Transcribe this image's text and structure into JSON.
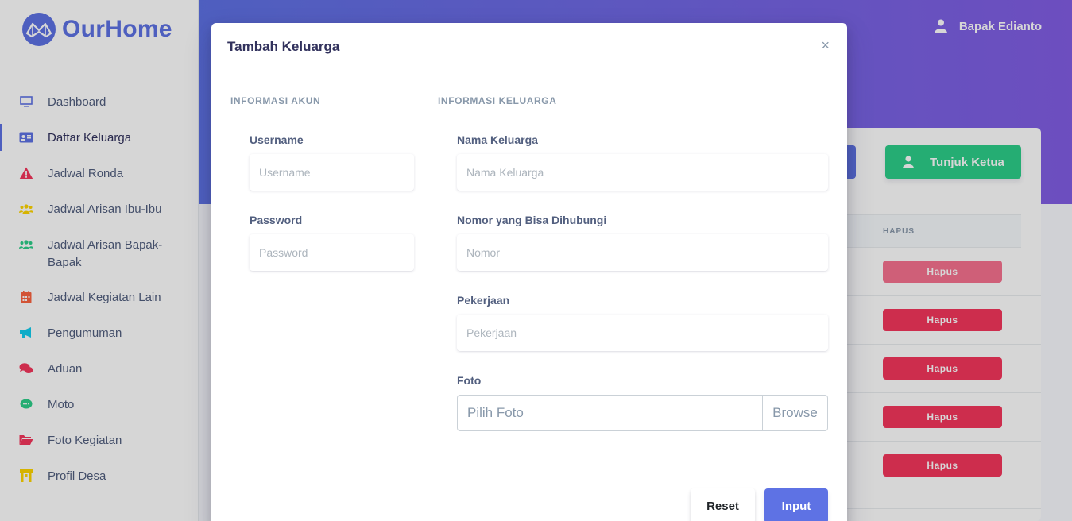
{
  "brand": {
    "name": "OurHome"
  },
  "sidebar": {
    "items": [
      {
        "label": "Dashboard",
        "icon": "monitor-icon",
        "color": "#5e72e4"
      },
      {
        "label": "Daftar Keluarga",
        "icon": "id-card-icon",
        "color": "#5e72e4"
      },
      {
        "label": "Jadwal Ronda",
        "icon": "warning-icon",
        "color": "#f5365c"
      },
      {
        "label": "Jadwal Arisan Ibu-Ibu",
        "icon": "users-icon",
        "color": "#ffd600"
      },
      {
        "label": "Jadwal Arisan Bapak-Bapak",
        "icon": "users-icon",
        "color": "#2dce89"
      },
      {
        "label": "Jadwal Kegiatan Lain",
        "icon": "calendar-icon",
        "color": "#fb6340"
      },
      {
        "label": "Pengumuman",
        "icon": "megaphone-icon",
        "color": "#11cdef"
      },
      {
        "label": "Aduan",
        "icon": "comments-icon",
        "color": "#f5365c"
      },
      {
        "label": "Moto",
        "icon": "comment-dots-icon",
        "color": "#2dce89"
      },
      {
        "label": "Foto Kegiatan",
        "icon": "folder-open-icon",
        "color": "#f5365c"
      },
      {
        "label": "Profil Desa",
        "icon": "gate-icon",
        "color": "#ffd600"
      }
    ]
  },
  "header": {
    "user_name": "Bapak Edianto"
  },
  "background": {
    "tunjuk_ketua": "Tunjuk Ketua",
    "column_hapus": "HAPUS",
    "rows": [
      "Hapus",
      "Hapus",
      "Hapus",
      "Hapus",
      "Hapus"
    ]
  },
  "modal": {
    "title": "Tambah Keluarga",
    "close": "×",
    "akun_section": "INFORMASI AKUN",
    "keluarga_section": "INFORMASI KELUARGA",
    "username_label": "Username",
    "username_placeholder": "Username",
    "password_label": "Password",
    "password_placeholder": "Password",
    "nama_label": "Nama Keluarga",
    "nama_placeholder": "Nama Keluarga",
    "nomor_label": "Nomor yang Bisa Dihubungi",
    "nomor_placeholder": "Nomor",
    "pekerjaan_label": "Pekerjaan",
    "pekerjaan_placeholder": "Pekerjaan",
    "foto_label": "Foto",
    "foto_placeholder": "Pilih Foto",
    "browse": "Browse",
    "reset": "Reset",
    "input": "Input"
  }
}
